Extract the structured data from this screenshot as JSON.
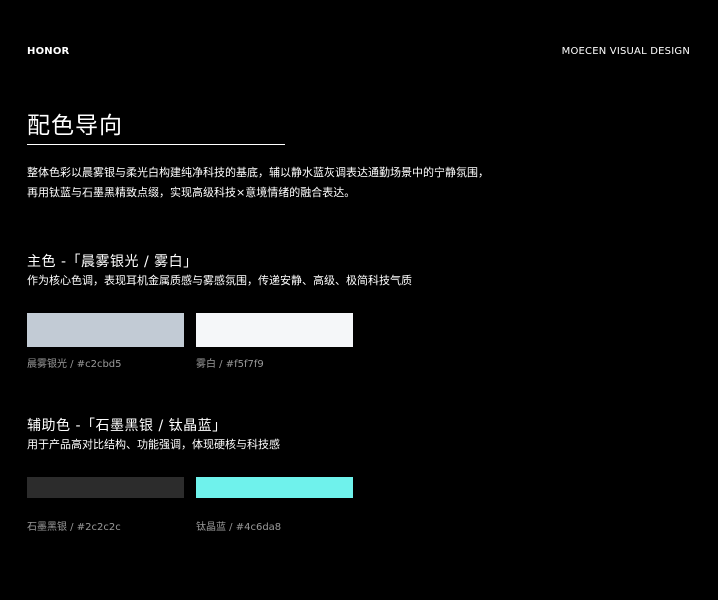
{
  "header": {
    "brand": "HONOR",
    "studio": "MOECEN VISUAL DESIGN"
  },
  "title": "配色导向",
  "intro": [
    "整体色彩以晨雾银与柔光白构建纯净科技的基底，辅以静水蓝灰调表达通勤场景中的宁静氛围，",
    "再用钛蓝与石墨黑精致点缀，实现高级科技×意境情绪的融合表达。"
  ],
  "primary": {
    "title": "主色 -「晨雾银光 / 雾白」",
    "subtitle": "作为核心色调，表现耳机金属质感与雾感氛围，传递安静、高级、极简科技气质",
    "swatches": [
      {
        "label": "晨雾银光 / #c2cbd5",
        "color": "#c2cbd5"
      },
      {
        "label": "雾白 / #f5f7f9",
        "color": "#f5f7f9"
      }
    ]
  },
  "secondary": {
    "title": "辅助色 -「石墨黑银 / 钛晶蓝」",
    "subtitle": "用于产品高对比结构、功能强调，体现硬核与科技感",
    "swatches": [
      {
        "label": "石墨黑银 / #2c2c2c",
        "color": "#2c2c2c"
      },
      {
        "label": "钛晶蓝 / #4c6da8",
        "color": "#6ff2ec"
      }
    ]
  }
}
